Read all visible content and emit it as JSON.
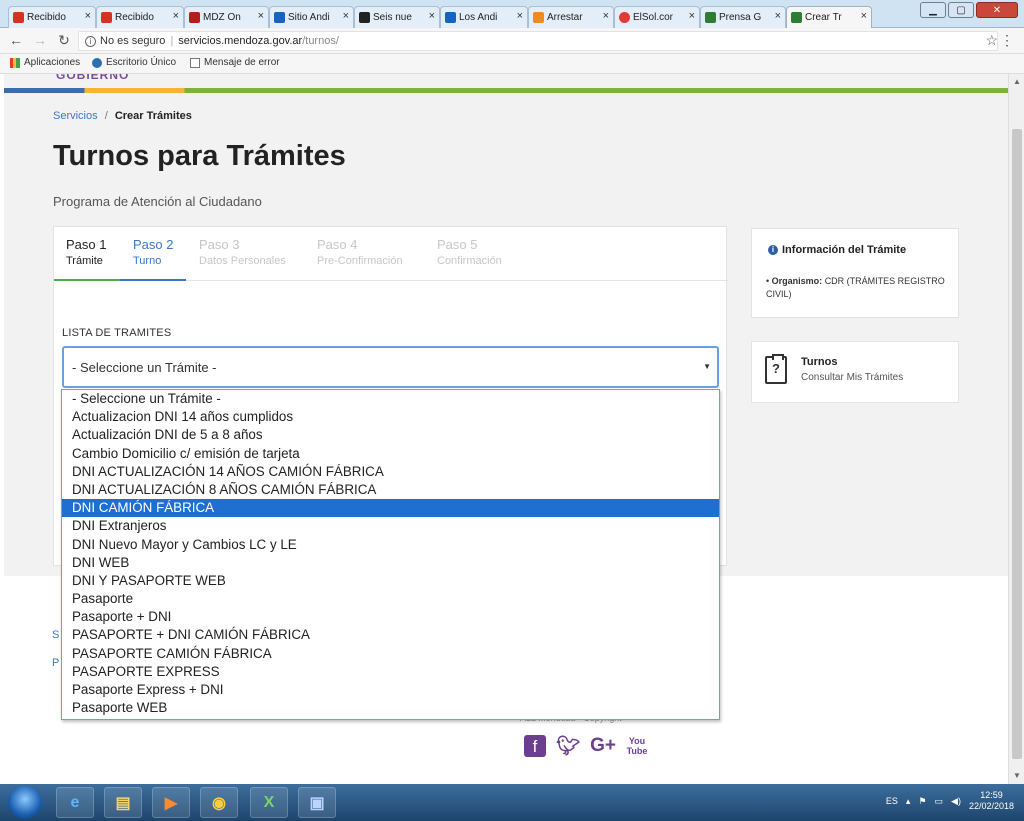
{
  "browser": {
    "tabs": [
      {
        "title": "Recibido",
        "icon_color": "#d93025"
      },
      {
        "title": "Recibido",
        "icon_color": "#d93025"
      },
      {
        "title": "MDZ On",
        "icon_color": "#b71c1c"
      },
      {
        "title": "Sitio Andi",
        "icon_color": "#1565c0"
      },
      {
        "title": "Seis nue",
        "icon_color": "#222222"
      },
      {
        "title": "Los Andi",
        "icon_color": "#1565c0"
      },
      {
        "title": "Arrestar",
        "icon_color": "#ef8b1a"
      },
      {
        "title": "ElSol.cor",
        "icon_color": "#e53935"
      },
      {
        "title": "Prensa G",
        "icon_color": "#2e7d32"
      },
      {
        "title": "Crear Tr",
        "icon_color": "#2e7d32"
      }
    ],
    "security_label": "No es seguro",
    "url_host": "servicios.mendoza.gov.ar",
    "url_path": "/turnos/",
    "bookmarks": [
      "Aplicaciones",
      "Escritorio Único",
      "Mensaje de error"
    ]
  },
  "header": {
    "logo_text": "GOBIERNO"
  },
  "breadcrumb": {
    "link": "Servicios",
    "separator": "/",
    "current": "Crear Trámites"
  },
  "title": "Turnos para Trámites",
  "subtitle": "Programa de Atención al Ciudadano",
  "steps": [
    {
      "number": "Paso 1",
      "label": "Trámite",
      "state": "done"
    },
    {
      "number": "Paso 2",
      "label": "Turno",
      "state": "active"
    },
    {
      "number": "Paso 3",
      "label": "Datos Personales",
      "state": "todo"
    },
    {
      "number": "Paso 4",
      "label": "Pre-Confirmación",
      "state": "todo"
    },
    {
      "number": "Paso 5",
      "label": "Confirmación",
      "state": "todo"
    }
  ],
  "form": {
    "list_label": "LISTA DE TRAMITES",
    "select_value": "- Seleccione un Trámite -",
    "options": [
      "- Seleccione un Trámite -",
      "Actualizacion DNI 14 años cumplidos",
      "Actualización DNI de 5 a 8 años",
      "Cambio Domicilio c/ emisión de tarjeta",
      "DNI ACTUALIZACIÓN 14 AÑOS CAMIÓN FÁBRICA",
      "DNI ACTUALIZACIÓN 8 AÑOS CAMIÓN FÁBRICA",
      "DNI CAMIÓN FÁBRICA",
      "DNI Extranjeros",
      "DNI Nuevo Mayor y Cambios LC y LE",
      "DNI WEB",
      "DNI Y PASAPORTE WEB",
      "Pasaporte",
      "Pasaporte + DNI",
      "PASAPORTE + DNI CAMIÓN FÁBRICA",
      "PASAPORTE CAMIÓN FÁBRICA",
      "PASAPORTE EXPRESS",
      "Pasaporte Express + DNI",
      "Pasaporte WEB"
    ],
    "highlighted_option": "DNI CAMIÓN FÁBRICA"
  },
  "info_card": {
    "title": "Información del Trámite",
    "organismo_label": "Organismo:",
    "organismo_value": "CDR (TRÁMITES REGISTRO CIVIL)"
  },
  "turnos_card": {
    "title": "Turnos",
    "subtitle": "Consultar Mis Trámites"
  },
  "footer": {
    "link_s": "S",
    "link_p": "P",
    "copyright_fragment": "ALL Mendoza - Copyright"
  },
  "taskbar": {
    "lang": "ES",
    "time": "12:59",
    "date": "22/02/2018"
  },
  "colors": {
    "accent_blue": "#3b78c3",
    "selected_option": "#1e6fd0",
    "step_done": "#4caf50",
    "brand_purple": "#6b3f8f"
  }
}
